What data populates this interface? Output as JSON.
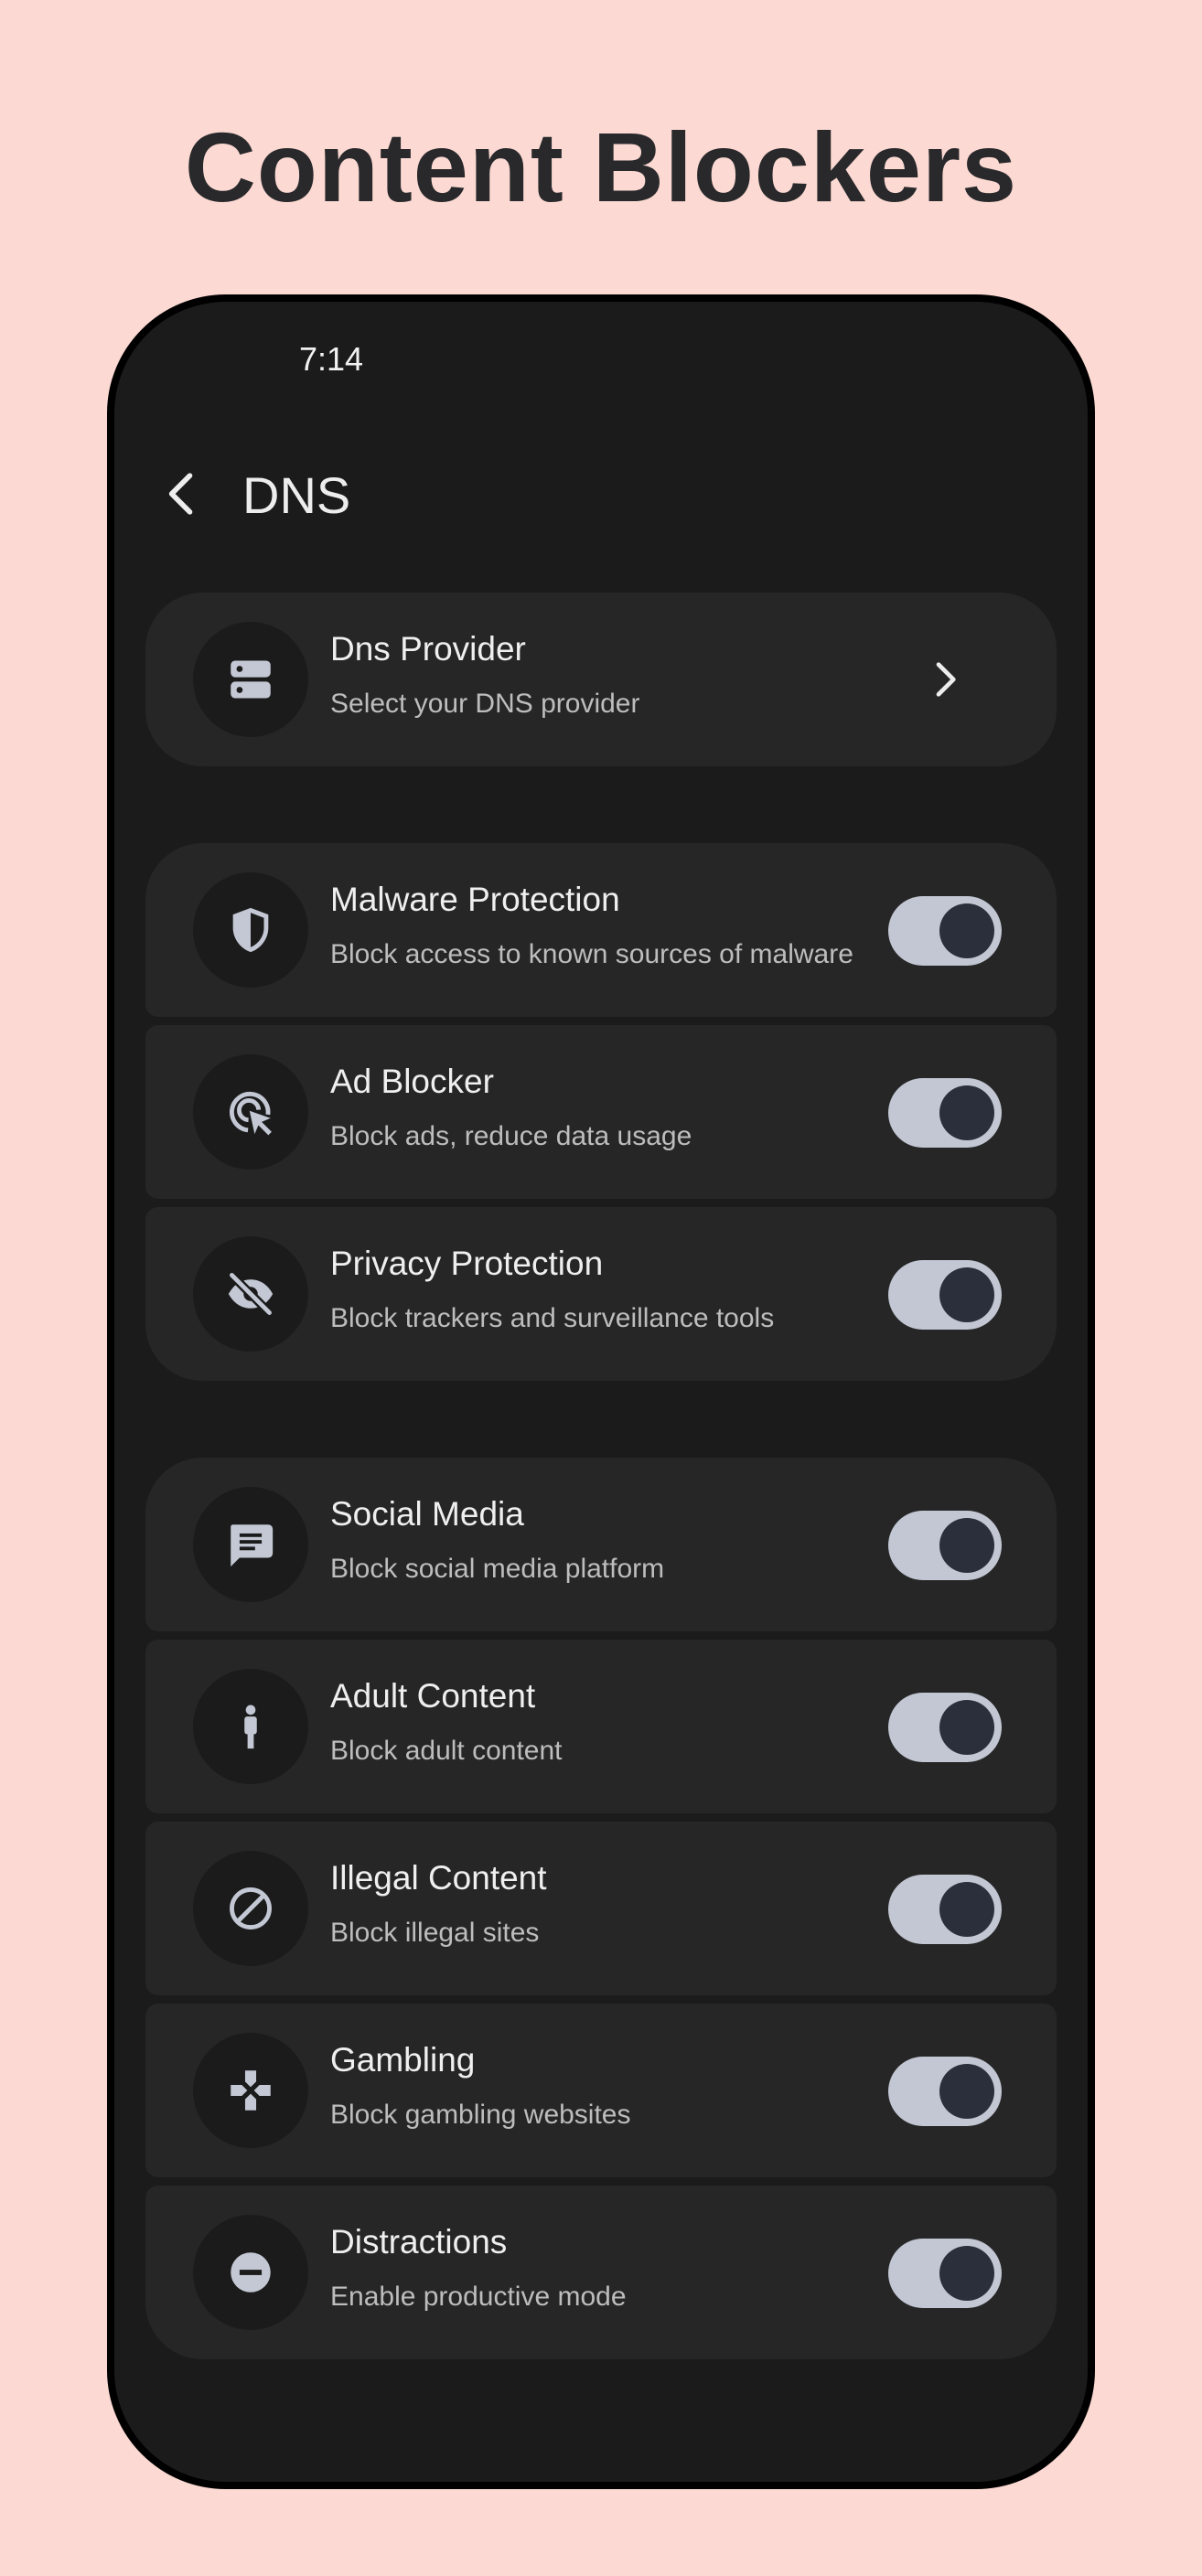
{
  "headline": "Content Blockers",
  "status_bar": {
    "time": "7:14"
  },
  "app_bar": {
    "back_icon": "arrow-back-icon",
    "title": "DNS"
  },
  "colors": {
    "page_background": "#FCD9D3",
    "screen_background": "#1B1B1B",
    "card_background": "#262626",
    "switch_track_on": "#C2C7D3",
    "switch_thumb_on": "#2A2F3B",
    "icon_tint": "#C3C8D4"
  },
  "provider": {
    "icon": "dns-server-icon",
    "title": "Dns Provider",
    "subtitle": "Select your DNS provider",
    "trailing_icon": "chevron-right-icon"
  },
  "protection_group": [
    {
      "icon": "shield-icon",
      "title": "Malware Protection",
      "subtitle": "Block access to known sources of malware",
      "enabled": true
    },
    {
      "icon": "ads-click-icon",
      "title": "Ad Blocker",
      "subtitle": "Block ads, reduce data usage",
      "enabled": true
    },
    {
      "icon": "visibility-off-icon",
      "title": "Privacy Protection",
      "subtitle": "Block trackers and surveillance tools",
      "enabled": true
    }
  ],
  "category_group": [
    {
      "icon": "chat-icon",
      "title": "Social Media",
      "subtitle": "Block social media platform",
      "enabled": true
    },
    {
      "icon": "person-icon",
      "title": "Adult Content",
      "subtitle": "Block adult content",
      "enabled": true
    },
    {
      "icon": "block-icon",
      "title": "Illegal Content",
      "subtitle": "Block illegal sites",
      "enabled": true
    },
    {
      "icon": "gamepad-icon",
      "title": "Gambling",
      "subtitle": "Block gambling websites",
      "enabled": true
    },
    {
      "icon": "do-not-disturb-icon",
      "title": "Distractions",
      "subtitle": "Enable productive mode",
      "enabled": true
    }
  ]
}
